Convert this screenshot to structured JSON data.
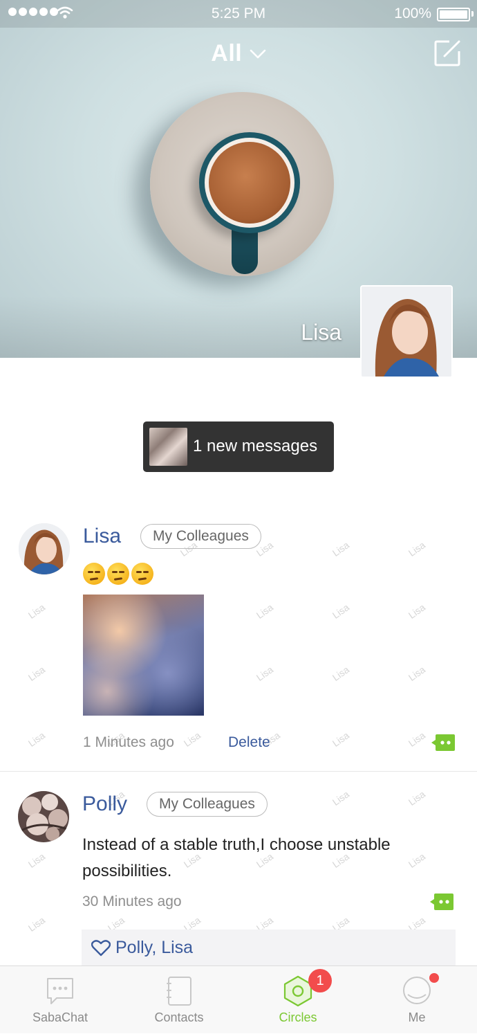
{
  "status_bar": {
    "time": "5:25 PM",
    "battery": "100%"
  },
  "header": {
    "title": "All"
  },
  "cover": {
    "user_name": "Lisa"
  },
  "new_messages": {
    "text": "1 new messages"
  },
  "posts": [
    {
      "author": "Lisa",
      "group": "My Colleagues",
      "content": "",
      "time": "1 Minutes ago",
      "delete_label": "Delete"
    },
    {
      "author": "Polly",
      "group": "My Colleagues",
      "content": "Instead of a stable truth,I choose unstable possibilities.",
      "time": "30 Minutes ago",
      "likes": "Polly, Lisa"
    }
  ],
  "watermark": "Lisa",
  "tabs": [
    {
      "label": "SabaChat"
    },
    {
      "label": "Contacts"
    },
    {
      "label": "Circles",
      "badge": "1"
    },
    {
      "label": "Me"
    }
  ],
  "colors": {
    "accent": "#7bc832",
    "link": "#3a5a9c",
    "badge": "#f24c4c"
  }
}
